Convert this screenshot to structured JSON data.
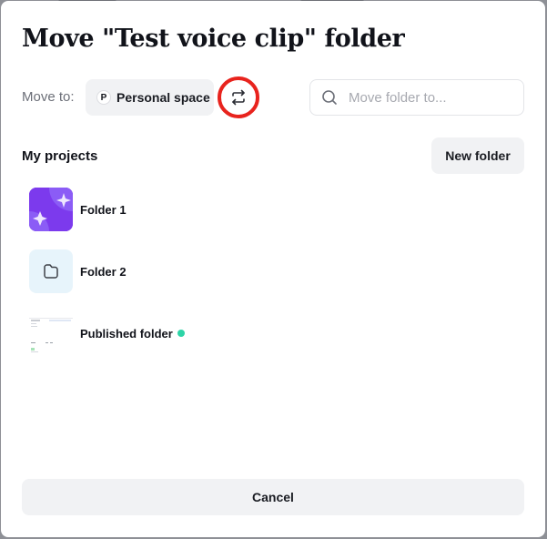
{
  "dialog": {
    "title": "Move \"Test voice clip\" folder",
    "move_to_label": "Move to:",
    "space": {
      "avatar_letter": "P",
      "label": "Personal space"
    },
    "switch_icon": "swap-arrows-icon",
    "search": {
      "icon": "search-icon",
      "value": "",
      "placeholder": "Move folder to..."
    },
    "section_title": "My projects",
    "new_folder_label": "New folder",
    "folders": [
      {
        "name": "Folder 1",
        "thumbnail": "purple-sparkle-thumbnail"
      },
      {
        "name": "Folder 2",
        "thumbnail": "folder-icon"
      },
      {
        "name": "Published folder",
        "thumbnail": "screenshot-thumbnail",
        "status": "published-dot"
      }
    ],
    "cancel_label": "Cancel"
  },
  "colors": {
    "highlight_ring": "#e8231d",
    "thumbnail_purple": "#7c3aed",
    "published_dot": "#2dd4a7",
    "button_bg": "#f1f2f4"
  }
}
